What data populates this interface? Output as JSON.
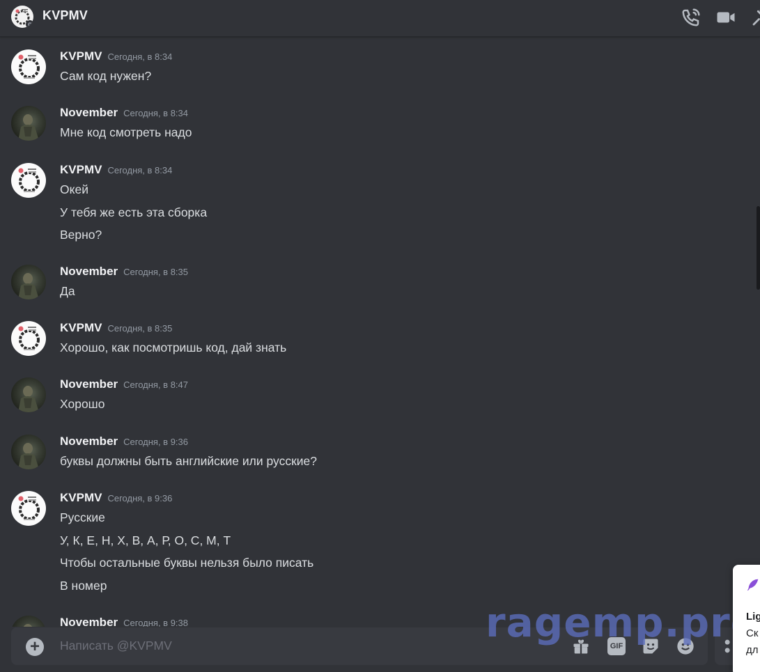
{
  "header": {
    "title": "KVPMV",
    "icons": [
      "voice-call-icon",
      "video-call-icon",
      "pin-icon"
    ]
  },
  "messages": [
    {
      "author": "KVPMV",
      "time": "Сегодня, в 8:34",
      "lines": [
        "Сам код нужен?"
      ]
    },
    {
      "author": "November",
      "time": "Сегодня, в 8:34",
      "lines": [
        "Мне код смотреть надо"
      ]
    },
    {
      "author": "KVPMV",
      "time": "Сегодня, в 8:34",
      "lines": [
        "Окей",
        "У тебя же есть эта сборка",
        "Верно?"
      ]
    },
    {
      "author": "November",
      "time": "Сегодня, в 8:35",
      "lines": [
        "Да"
      ]
    },
    {
      "author": "KVPMV",
      "time": "Сегодня, в 8:35",
      "lines": [
        "Хорошо, как посмотришь код, дай знать"
      ]
    },
    {
      "author": "November",
      "time": "Сегодня, в 8:47",
      "lines": [
        "Хорошо"
      ]
    },
    {
      "author": "November",
      "time": "Сегодня, в 9:36",
      "lines": [
        "буквы должны быть английские или русские?"
      ]
    },
    {
      "author": "KVPMV",
      "time": "Сегодня, в 9:36",
      "lines": [
        "Русские",
        "У, К, Е, Н, Х, В, А, Р, О, С, М, Т",
        "Чтобы остальные буквы нельзя было писать",
        "В номер"
      ]
    },
    {
      "author": "November",
      "time": "Сегодня, в 9:38",
      "lines": []
    }
  ],
  "composer": {
    "placeholder": "Написать @KVPMV",
    "gif_label": "GIF",
    "icons": [
      "add-attachment-icon",
      "gift-icon",
      "gif-icon",
      "sticker-icon",
      "emoji-icon",
      "apps-icon"
    ]
  },
  "watermark": "ragemp.pro",
  "notification": {
    "lines": [
      "Lig",
      "Ск",
      "дл"
    ]
  },
  "colors": {
    "background": "#313338",
    "composer": "#383a40",
    "author": "#f2f3f5",
    "text": "#dbdee1",
    "timestamp": "#949ba4"
  }
}
